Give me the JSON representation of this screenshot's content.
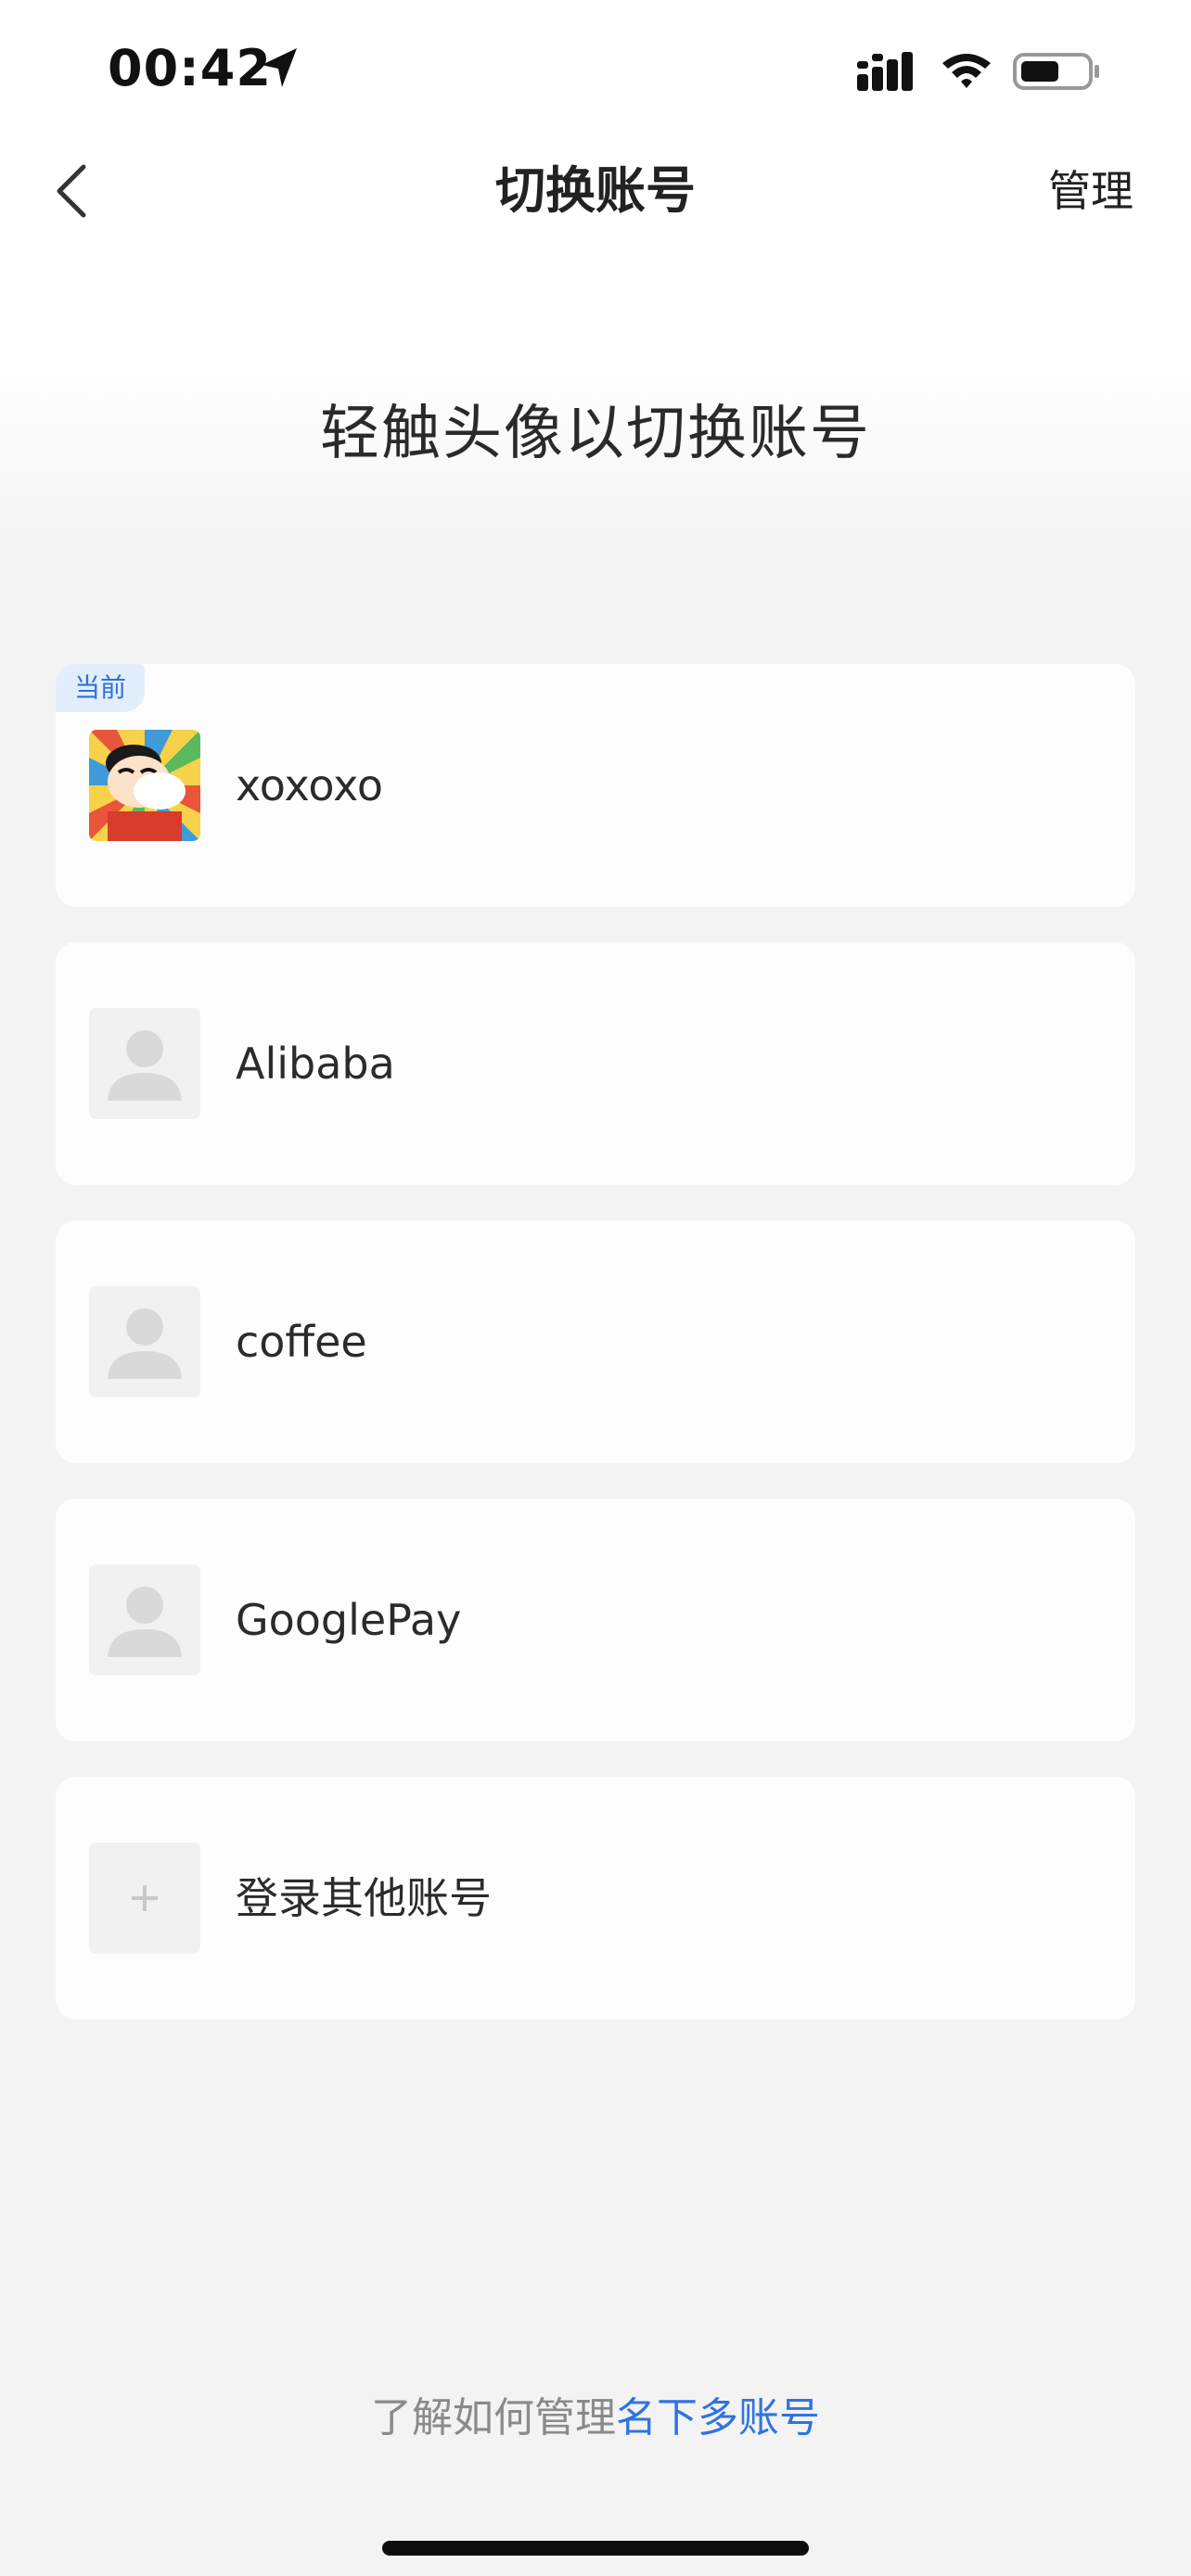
{
  "status_bar": {
    "time": "00:42",
    "icons": [
      "location-arrow-icon",
      "signal-icon",
      "wifi-icon",
      "battery-icon"
    ]
  },
  "nav": {
    "back_icon": "chevron-left-icon",
    "title": "切换账号",
    "manage_label": "管理"
  },
  "hint": "轻触头像以切换账号",
  "accounts": [
    {
      "name": "xoxoxo",
      "badge": "当前",
      "avatar": "cartoon-avatar"
    },
    {
      "name": "Alibaba",
      "avatar": "default-person-icon"
    },
    {
      "name": "coffee",
      "avatar": "default-person-icon"
    },
    {
      "name": "GooglePay",
      "avatar": "default-person-icon"
    }
  ],
  "add_account": {
    "label": "登录其他账号",
    "icon": "plus-icon"
  },
  "footer": {
    "static_text": "了解如何管理",
    "link_text": "名下多账号"
  },
  "colors": {
    "accent": "#2f73e3",
    "badge_bg": "#e3eefc",
    "page_bg": "#f3f3f3",
    "card_bg": "#fdfdfd"
  }
}
